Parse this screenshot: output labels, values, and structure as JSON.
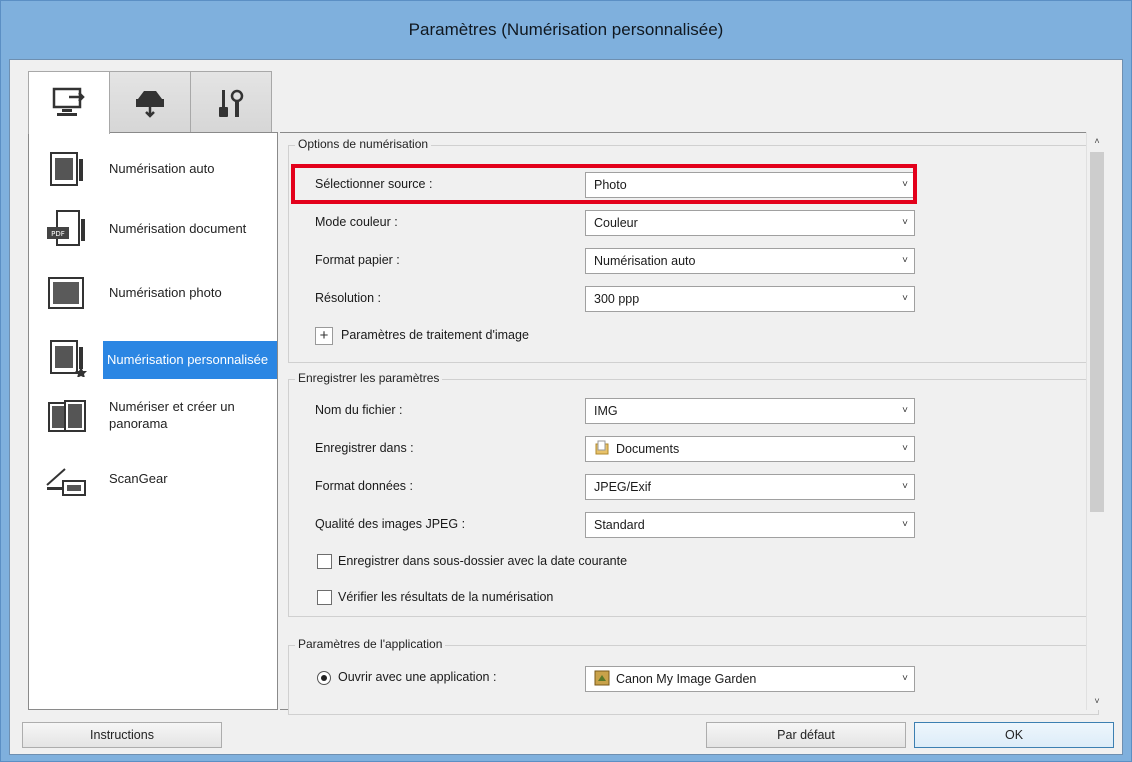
{
  "window": {
    "title": "Paramètres (Numérisation personnalisée)"
  },
  "tabs": [
    {
      "icon": "scan-from-computer-icon",
      "active": true
    },
    {
      "icon": "scan-from-operation-panel-icon",
      "active": false
    },
    {
      "icon": "general-settings-tools-icon",
      "active": false
    }
  ],
  "sidebar": {
    "items": [
      {
        "label": "Numérisation auto",
        "icon": "auto-scan-icon"
      },
      {
        "label": "Numérisation document",
        "icon": "document-scan-icon"
      },
      {
        "label": "Numérisation photo",
        "icon": "photo-scan-icon"
      },
      {
        "label": "Numérisation personnalisée",
        "icon": "custom-scan-icon",
        "selected": true
      },
      {
        "label": "Numériser et créer un panorama",
        "icon": "stitch-scan-icon"
      },
      {
        "label": "ScanGear",
        "icon": "scangear-icon"
      }
    ]
  },
  "scan_options": {
    "legend": "Options de numérisation",
    "source": {
      "label": "Sélectionner source :",
      "value": "Photo"
    },
    "color_mode": {
      "label": "Mode couleur :",
      "value": "Couleur"
    },
    "paper_size": {
      "label": "Format papier :",
      "value": "Numérisation auto"
    },
    "resolution": {
      "label": "Résolution :",
      "value": "300 ppp"
    },
    "image_processing": {
      "expander": "+",
      "label": "Paramètres de traitement d'image"
    }
  },
  "save_settings": {
    "legend": "Enregistrer les paramètres",
    "file_name": {
      "label": "Nom du fichier :",
      "value": "IMG"
    },
    "save_in": {
      "label": "Enregistrer dans :",
      "value": "Documents"
    },
    "data_format": {
      "label": "Format données :",
      "value": "JPEG/Exif"
    },
    "jpeg_quality": {
      "label": "Qualité des images JPEG :",
      "value": "Standard"
    },
    "subfolder_checkbox": {
      "label": "Enregistrer dans sous-dossier avec la date courante",
      "checked": false
    },
    "check_results_checkbox": {
      "label": "Vérifier les résultats de la numérisation",
      "checked": false
    }
  },
  "app_settings": {
    "legend": "Paramètres de l'application",
    "open_with": {
      "label": "Ouvrir avec une application :",
      "value": "Canon My Image Garden",
      "selected": true
    }
  },
  "scrollbar": {
    "up": "˄",
    "down": "˅"
  },
  "combo_arrow": "˅",
  "buttons": {
    "instructions": "Instructions",
    "defaults": "Par défaut",
    "ok": "OK"
  }
}
